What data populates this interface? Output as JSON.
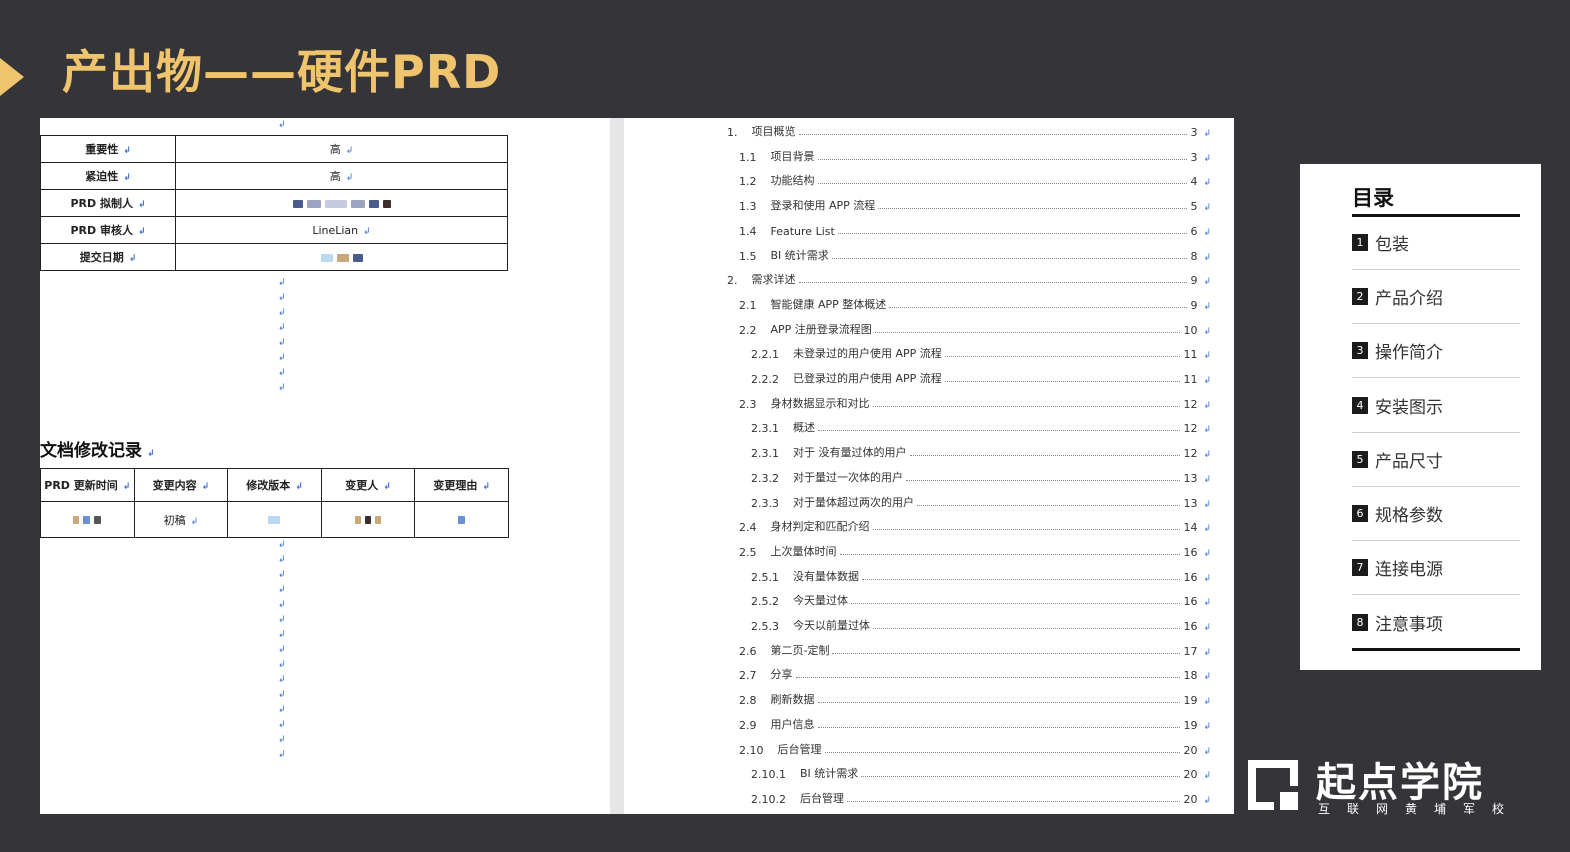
{
  "slide": {
    "title": "产出物——硬件PRD"
  },
  "doc_info": {
    "rows": [
      {
        "label": "重要性",
        "value": "高"
      },
      {
        "label": "紧迫性",
        "value": "高"
      },
      {
        "label": "PRD 拟制人",
        "value": ""
      },
      {
        "label": "PRD 审核人",
        "value": "LineLian"
      },
      {
        "label": "提交日期",
        "value": ""
      }
    ]
  },
  "revision": {
    "heading": "文档修改记录",
    "headers": [
      "PRD 更新时间",
      "变更内容",
      "修改版本",
      "变更人",
      "变更理由"
    ],
    "rows": [
      [
        "",
        "初稿",
        "",
        "",
        ""
      ]
    ]
  },
  "toc": [
    {
      "num": "1.",
      "text": "项目概览",
      "page": "3"
    },
    {
      "num": "1.1",
      "text": "项目背景",
      "page": "3"
    },
    {
      "num": "1.2",
      "text": "功能结构",
      "page": "4"
    },
    {
      "num": "1.3",
      "text": "登录和使用 APP 流程",
      "page": "5"
    },
    {
      "num": "1.4",
      "text": "Feature List",
      "page": "6"
    },
    {
      "num": "1.5",
      "text": "BI 统计需求",
      "page": "8"
    },
    {
      "num": "2.",
      "text": "需求详述",
      "page": "9"
    },
    {
      "num": "2.1",
      "text": "智能健康 APP 整体概述",
      "page": "9"
    },
    {
      "num": "2.2",
      "text": "APP 注册登录流程图",
      "page": "10"
    },
    {
      "num": "2.2.1",
      "text": "未登录过的用户使用 APP 流程",
      "page": "11"
    },
    {
      "num": "2.2.2",
      "text": "已登录过的用户使用 APP 流程",
      "page": "11"
    },
    {
      "num": "2.3",
      "text": "身材数据显示和对比",
      "page": "12"
    },
    {
      "num": "2.3.1",
      "text": "概述",
      "page": "12"
    },
    {
      "num": "2.3.1",
      "text": "对于 没有量过体的用户",
      "page": "12"
    },
    {
      "num": "2.3.2",
      "text": "对于量过一次体的用户",
      "page": "13"
    },
    {
      "num": "2.3.3",
      "text": "对于量体超过两次的用户",
      "page": "13"
    },
    {
      "num": "2.4",
      "text": "身材判定和匹配介绍",
      "page": "14"
    },
    {
      "num": "2.5",
      "text": "上次量体时间",
      "page": "16"
    },
    {
      "num": "2.5.1",
      "text": "没有量体数据",
      "page": "16"
    },
    {
      "num": "2.5.2",
      "text": "今天量过体",
      "page": "16"
    },
    {
      "num": "2.5.3",
      "text": "今天以前量过体",
      "page": "16"
    },
    {
      "num": "2.6",
      "text": "第二页-定制",
      "page": "17"
    },
    {
      "num": "2.7",
      "text": "分享",
      "page": "18"
    },
    {
      "num": "2.8",
      "text": "刷新数据",
      "page": "19"
    },
    {
      "num": "2.9",
      "text": "用户信息",
      "page": "19"
    },
    {
      "num": "2.10",
      "text": "后台管理",
      "page": "20"
    },
    {
      "num": "2.10.1",
      "text": "BI 统计需求",
      "page": "20"
    },
    {
      "num": "2.10.2",
      "text": "后台管理",
      "page": "20"
    }
  ],
  "catalog": {
    "title": "目录",
    "items": [
      {
        "num": "1",
        "label": "包装"
      },
      {
        "num": "2",
        "label": "产品介绍"
      },
      {
        "num": "3",
        "label": "操作简介"
      },
      {
        "num": "4",
        "label": "安装图示"
      },
      {
        "num": "5",
        "label": "产品尺寸"
      },
      {
        "num": "6",
        "label": "规格参数"
      },
      {
        "num": "7",
        "label": "连接电源"
      },
      {
        "num": "8",
        "label": "注意事项"
      }
    ]
  },
  "brand": {
    "name": "起点学院",
    "subtitle": "互联网黄埔军校"
  },
  "colors": {
    "accent": "#f0c46c",
    "background": "#343439",
    "paragraph_mark": "#3a6fd8"
  }
}
